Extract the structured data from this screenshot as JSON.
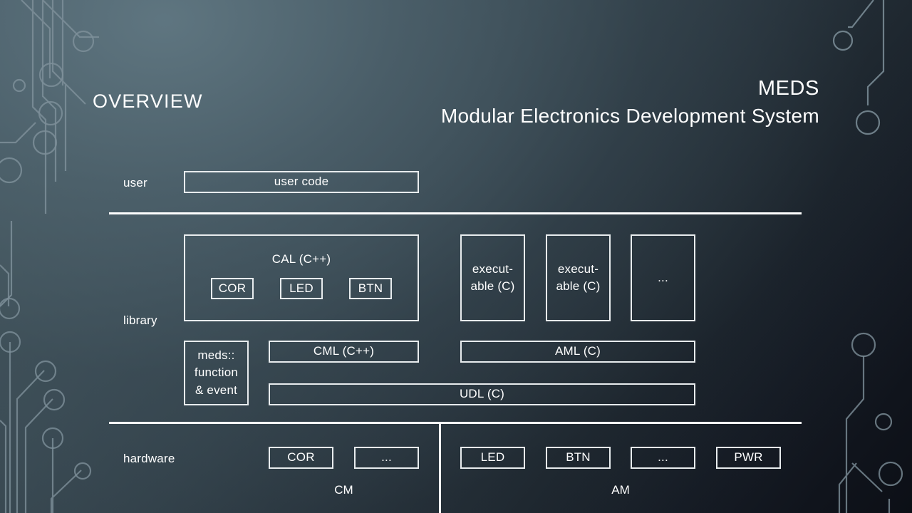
{
  "header": {
    "title": "Overview",
    "brand": "MEDS",
    "brand_subtitle": "Modular Electronics Development System"
  },
  "diagram": {
    "layer_labels": {
      "user": "user",
      "library": "library",
      "hardware": "hardware"
    },
    "user_layer": {
      "box": "user code"
    },
    "library_layer": {
      "cal_group_title": "CAL (C++)",
      "cal_modules": [
        "COR",
        "LED",
        "BTN"
      ],
      "executables": [
        "execut-\nable (C)",
        "execut-\nable (C)",
        "..."
      ],
      "meds_block": "meds::\nfunction\n& event",
      "cml": "CML (C++)",
      "aml": "AML (C)",
      "udl": "UDL (C)"
    },
    "hardware_layer": {
      "cm_modules": [
        "COR",
        "..."
      ],
      "am_modules": [
        "LED",
        "BTN",
        "...",
        "PWR"
      ],
      "cm_caption": "CM",
      "am_caption": "AM"
    }
  },
  "theme": {
    "stroke": "#e8ecee",
    "text": "#ffffff",
    "bg_light": "#4c5f69",
    "bg_dark": "#0c0f16",
    "trace": "#7d8f99"
  }
}
